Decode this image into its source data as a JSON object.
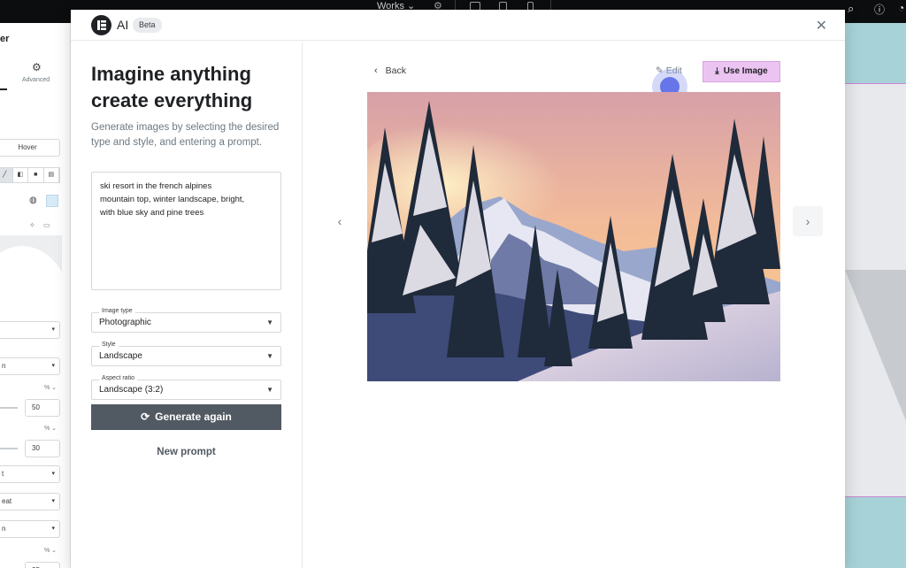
{
  "topbar": {
    "preset": "Works",
    "preset_caret": "⌄"
  },
  "left_panel": {
    "title": "er",
    "advanced_label": "Advanced",
    "hover_label": "Hover",
    "values": {
      "a": "50",
      "b": "30",
      "c": "25"
    },
    "unit": "% ⌄",
    "selects": [
      "",
      "n",
      "t",
      "eat",
      "n"
    ]
  },
  "modal": {
    "title": "AI",
    "badge": "Beta",
    "close": "✕",
    "headline": "Imagine anything create everything",
    "description": "Generate images by selecting the desired type and style, and entering a prompt.",
    "prompt": "ski resort in the french alpines\nmountain top, winter landscape, bright,\nwith blue sky and pine trees",
    "fields": {
      "image_type": {
        "label": "Image type",
        "value": "Photographic"
      },
      "style": {
        "label": "Style",
        "value": "Landscape"
      },
      "aspect_ratio": {
        "label": "Aspect ratio",
        "value": "Landscape (3:2)"
      }
    },
    "generate_label": "Generate again",
    "new_prompt_label": "New prompt",
    "back_label": "Back",
    "edit_label": "Edit",
    "use_image_label": "Use Image"
  },
  "colors": {
    "primary_button": "#515962",
    "use_image_bg": "#ecc4f2",
    "canvas_accent": "#a7d3d8"
  }
}
